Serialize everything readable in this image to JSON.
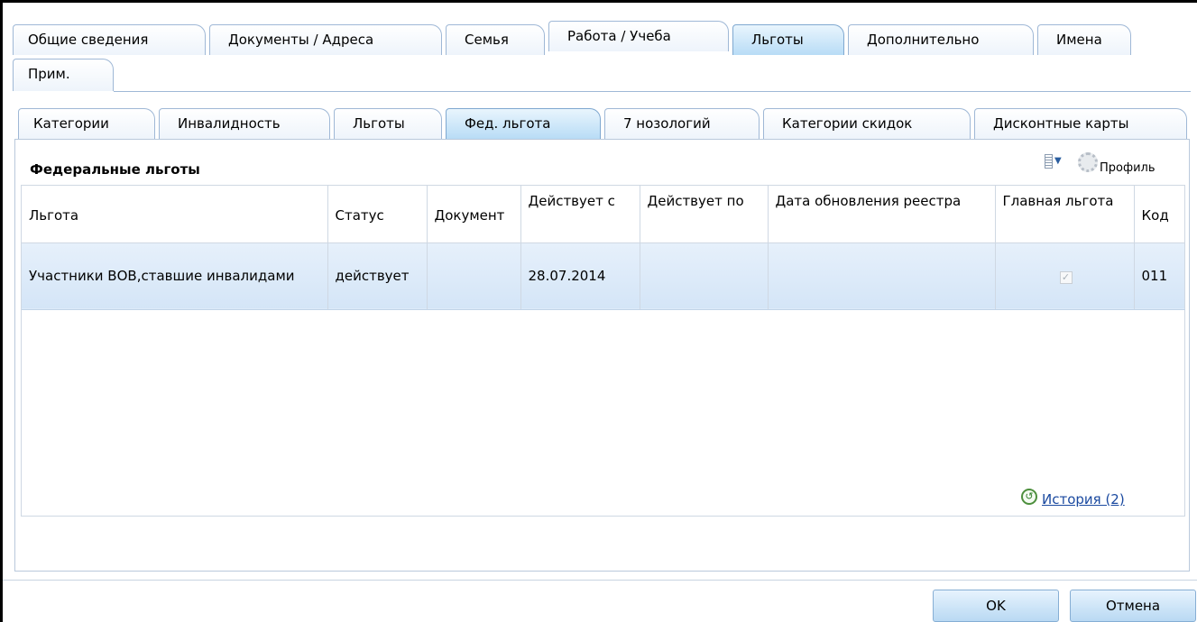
{
  "main_tabs": [
    {
      "label": "Общие сведения"
    },
    {
      "label": "Документы / Адреса"
    },
    {
      "label": "Семья"
    },
    {
      "label": "Работа / Учеба"
    },
    {
      "label": "Льготы"
    },
    {
      "label": "Дополнительно"
    },
    {
      "label": "Имена"
    },
    {
      "label": "Прим."
    }
  ],
  "active_main_tab": "Льготы",
  "sub_tabs": [
    {
      "label": "Категории"
    },
    {
      "label": "Инвалидность"
    },
    {
      "label": "Льготы"
    },
    {
      "label": "Фед. льгота"
    },
    {
      "label": "7 нозологий"
    },
    {
      "label": "Категории скидок"
    },
    {
      "label": "Дисконтные карты"
    }
  ],
  "active_sub_tab": "Фед. льгота",
  "panel": {
    "title": "Федеральные льготы",
    "profile_label": "Профиль"
  },
  "grid": {
    "columns": [
      {
        "label": "Льгота"
      },
      {
        "label": "Статус"
      },
      {
        "label": "Документ"
      },
      {
        "label": "Действует с"
      },
      {
        "label": "Действует по"
      },
      {
        "label": "Дата обновления реестра"
      },
      {
        "label": "Главная льгота"
      },
      {
        "label": "Код"
      }
    ],
    "rows": [
      {
        "benefit": "Участники ВОВ,ставшие инвалидами",
        "status": "действует",
        "document": "",
        "valid_from": "28.07.2014",
        "valid_to": "",
        "registry_update": "",
        "main_benefit": true,
        "code": "011"
      }
    ]
  },
  "history_link": "История (2)",
  "buttons": {
    "ok": "OK",
    "cancel": "Отмена"
  },
  "colors": {
    "active_tab": "#b8dcf6",
    "selected_row": "#d9e8f8",
    "link": "#1b4aa0"
  }
}
